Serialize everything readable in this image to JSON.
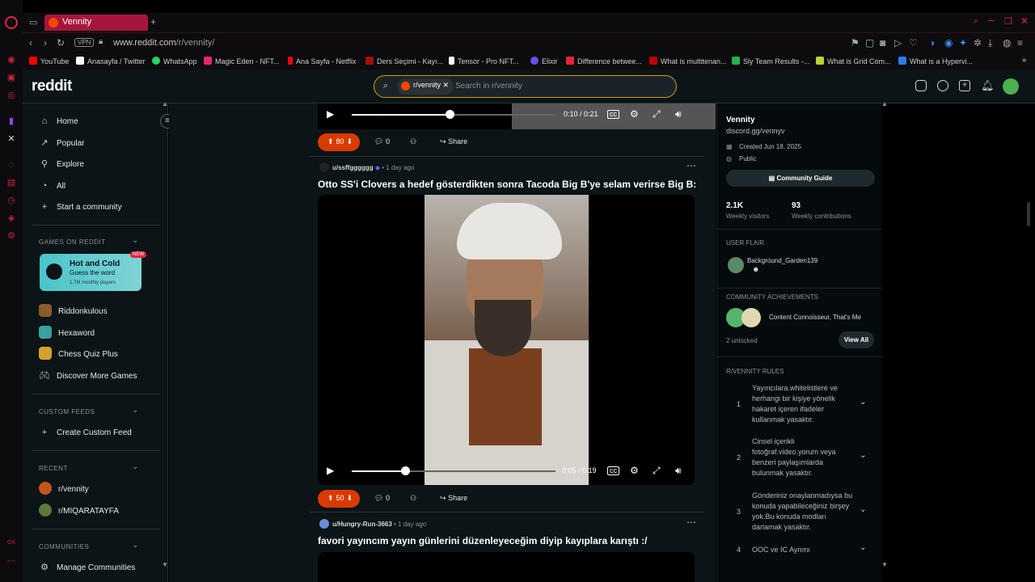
{
  "browser": {
    "tab_title": "Vennity",
    "url_domain": "www.reddit.com",
    "url_path": "/r/vennity/",
    "vpn": "VPN"
  },
  "bookmarks": [
    {
      "label": "YouTube",
      "color": "#ff0000"
    },
    {
      "label": "Anasayfa / Twitter",
      "color": "#ffffff"
    },
    {
      "label": "WhatsApp",
      "color": "#25d366"
    },
    {
      "label": "Magic Eden - NFT...",
      "color": "#e42575"
    },
    {
      "label": "Ana Sayfa - Netflix",
      "color": "#e50914"
    },
    {
      "label": "Ders Seçimi - Kayı...",
      "color": "#a01010"
    },
    {
      "label": "Tensor - Pro NFT...",
      "color": "#ffffff"
    },
    {
      "label": "Elixir",
      "color": "#6b4cf0"
    },
    {
      "label": "Difference betwee...",
      "color": "#e0263d"
    },
    {
      "label": "What is multitenan...",
      "color": "#c00000"
    },
    {
      "label": "Sly Team Results -...",
      "color": "#22b14c"
    },
    {
      "label": "What is Grid Com...",
      "color": "#b5d334"
    },
    {
      "label": "What is a Hypervi...",
      "color": "#2c7be5"
    }
  ],
  "reddit": {
    "logo": "reddit",
    "search_chip": "r/vennity",
    "search_placeholder": "Search in r/vennity"
  },
  "nav": {
    "home": "Home",
    "popular": "Popular",
    "explore": "Explore",
    "all": "All",
    "start_community": "Start a community",
    "games_section": "GAMES ON REDDIT",
    "game_card_title": "Hot and Cold",
    "game_card_sub": "Guess the word",
    "game_card_meta": "1.7M monthly players",
    "new_badge": "NEW",
    "games": [
      "Riddonkulous",
      "Hexaword",
      "Chess Quiz Plus",
      "Discover More Games"
    ],
    "custom_feeds_section": "CUSTOM FEEDS",
    "create_custom_feed": "Create Custom Feed",
    "recent_section": "RECENT",
    "recent": [
      "r/vennity",
      "r/MIQARATAYFA"
    ],
    "communities_section": "COMMUNITIES",
    "manage_communities": "Manage Communities"
  },
  "post1": {
    "time": "0:10 / 0:21",
    "progress": 0.48,
    "votes": "80",
    "comments": "0",
    "share": "Share"
  },
  "post2": {
    "author": "u/ssffgggggg",
    "age": "1 day ago",
    "title": "Otto SS'i Clovers a hedef gösterdikten sonra Tacoda Big B'ye selam verirse Big B:",
    "time": "0:05 / 0:19",
    "progress": 0.26,
    "votes": "50",
    "comments": "0",
    "share": "Share"
  },
  "post3": {
    "author": "u/Hungry-Run-3663",
    "age": "1 day ago",
    "title": "favori yayıncım yayın günlerini düzenleyeceğim diyip kayıplara karıştı :/"
  },
  "community": {
    "name": "Vennity",
    "link": "discord.gg/vennyv",
    "created": "Created Jun 18, 2025",
    "visibility": "Public",
    "guide": "Community Guide",
    "visitors_num": "2.1K",
    "visitors_lbl": "Weekly visitors",
    "contrib_num": "93",
    "contrib_lbl": "Weekly contributions",
    "flair_section": "USER FLAIR",
    "flair_user": "Background_Garden139",
    "achievements_section": "COMMUNITY ACHIEVEMENTS",
    "achievements": "Content Connoisseur, That's Me",
    "unlocked": "2 unlocked",
    "view_all": "View All",
    "rules_section": "R/VENNITY RULES",
    "rules": [
      {
        "n": "1",
        "text": "Yayıncılara.whitelistlere ve herhangi bir kişiye yönelik hakaret içeren ifadeler kullanmak yasaktır."
      },
      {
        "n": "2",
        "text": "Cinsel içerikli fotoğraf.video.yorum veya benzeri paylaşımlarda bulunmak yasaktır."
      },
      {
        "n": "3",
        "text": "Gönderiniz onaylanmadıysa bu konuda yapabileceğiniz birşey yok.Bu konuda modları darlamak yasaktır."
      },
      {
        "n": "4",
        "text": "OOC ve IC Ayrımı"
      }
    ]
  },
  "colors": {
    "accent": "#d93a00",
    "tab": "#a6163a",
    "search_border": "#d99a0b"
  }
}
